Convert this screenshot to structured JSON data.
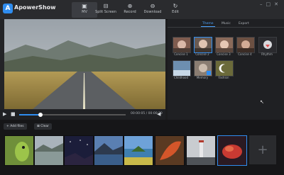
{
  "app": {
    "name": "ApowerShow",
    "logo_glyph": "A"
  },
  "toolbar": {
    "items": [
      {
        "label": "MV",
        "icon": "film-icon",
        "active": true
      },
      {
        "label": "Split Screen",
        "icon": "split-screen-icon",
        "active": false
      },
      {
        "label": "Record",
        "icon": "record-icon",
        "active": false
      },
      {
        "label": "Download",
        "icon": "download-icon",
        "active": false
      },
      {
        "label": "Edit",
        "icon": "edit-icon",
        "active": false
      }
    ],
    "window_controls": [
      "minimize-icon",
      "maximize-icon",
      "close-icon"
    ]
  },
  "player": {
    "time": "00:00:05 / 00:00:20",
    "progress": 0.2
  },
  "panel": {
    "tabs": [
      "Theme",
      "Music",
      "Export"
    ],
    "active_tab": "Theme",
    "themes": [
      {
        "label": "Concise 1"
      },
      {
        "label": "Concise 2",
        "selected": true
      },
      {
        "label": "Concise 3"
      },
      {
        "label": "Concise 4"
      },
      {
        "label": "Rhythm"
      },
      {
        "label": "Childhood"
      },
      {
        "label": "Memory"
      },
      {
        "label": "Fashion"
      }
    ]
  },
  "media": {
    "add_files_label": "Add files",
    "clear_label": "Clear",
    "thumbnails": [
      "lizard",
      "lake",
      "starry-sky",
      "mountain-lake",
      "lake-island",
      "red-leaf",
      "lighthouse",
      "red-coral",
      "empty"
    ],
    "selected_index": 7
  },
  "colors": {
    "accent": "#2f8df0",
    "background": "#1c1c1e"
  }
}
